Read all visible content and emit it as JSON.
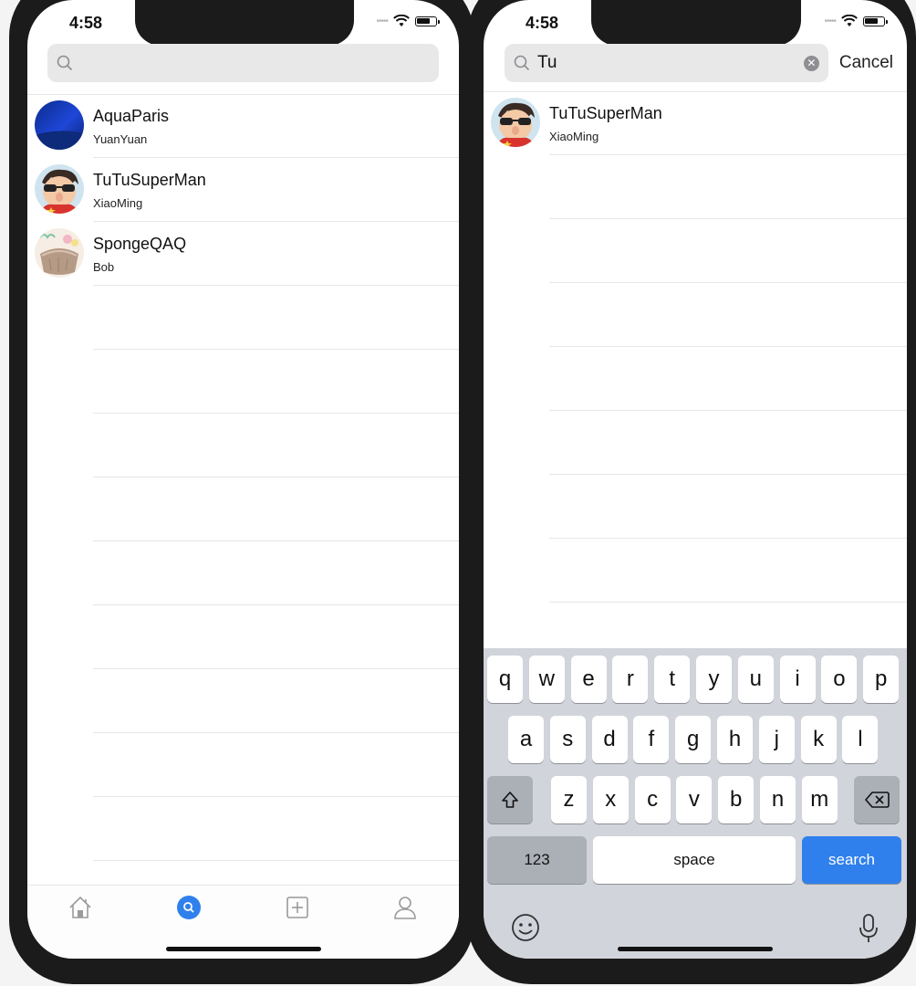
{
  "left": {
    "status": {
      "time": "4:58"
    },
    "search": {
      "value": ""
    },
    "contacts": [
      {
        "name": "AquaParis",
        "sub": "YuanYuan",
        "avatar": "blue-night-sky"
      },
      {
        "name": "TuTuSuperMan",
        "sub": "XiaoMing",
        "avatar": "cartoon-sunglasses-boy"
      },
      {
        "name": "SpongeQAQ",
        "sub": "Bob",
        "avatar": "cartoon-bowl"
      }
    ],
    "empty_rows": 9,
    "tabs": [
      {
        "icon": "home-icon",
        "active": false
      },
      {
        "icon": "search-icon",
        "active": true
      },
      {
        "icon": "plus-square-icon",
        "active": false
      },
      {
        "icon": "person-icon",
        "active": false
      }
    ],
    "colors": {
      "accent": "#2f80ed"
    }
  },
  "right": {
    "status": {
      "time": "4:58"
    },
    "search": {
      "value": "Tu",
      "cancel_label": "Cancel"
    },
    "results": [
      {
        "name": "TuTuSuperMan",
        "sub": "XiaoMing",
        "avatar": "cartoon-sunglasses-boy"
      }
    ],
    "empty_rows": 7,
    "keyboard": {
      "row1": [
        "q",
        "w",
        "e",
        "r",
        "t",
        "y",
        "u",
        "i",
        "o",
        "p"
      ],
      "row2": [
        "a",
        "s",
        "d",
        "f",
        "g",
        "h",
        "j",
        "k",
        "l"
      ],
      "row3": [
        "z",
        "x",
        "c",
        "v",
        "b",
        "n",
        "m"
      ],
      "numbers_label": "123",
      "space_label": "space",
      "search_label": "search"
    }
  }
}
